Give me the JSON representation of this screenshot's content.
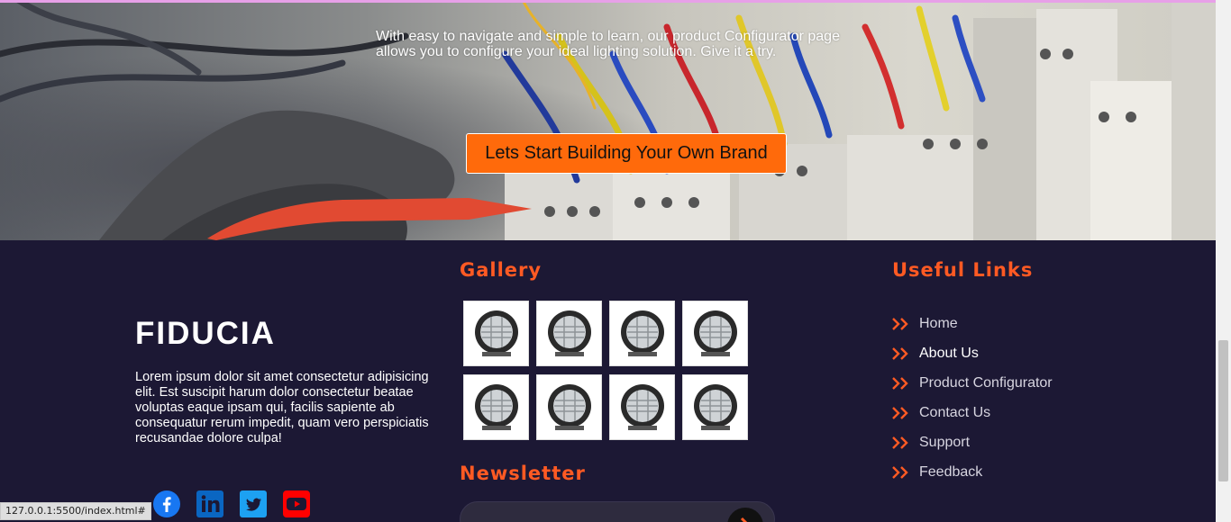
{
  "hero": {
    "description": "With easy to navigate and simple to learn, our product Configurator page allows you to configure your ideal lighting solution. Give it a try.",
    "cta_label": "Lets Start Building Your Own Brand"
  },
  "footer": {
    "brand": "FIDUCIA",
    "about": "Lorem ipsum dolor sit amet consectetur adipisicing elit. Est suscipit harum dolor consectetur beatae voluptas eaque ipsam qui, facilis sapiente ab consequatur rerum impedit, quam vero perspiciatis recusandae dolore culpa!",
    "socials": [
      {
        "icon": "facebook-icon",
        "color": "#1877f2"
      },
      {
        "icon": "linkedin-icon",
        "color": "#0a66c2"
      },
      {
        "icon": "twitter-icon",
        "color": "#1da1f2"
      },
      {
        "icon": "youtube-icon",
        "color": "#ff0000"
      }
    ]
  },
  "gallery": {
    "title": "Gallery",
    "images": [
      "work-light-image",
      "work-light-image",
      "work-light-image",
      "work-light-image",
      "work-light-image",
      "work-light-image",
      "work-light-image",
      "work-light-image"
    ]
  },
  "newsletter": {
    "title": "Newsletter"
  },
  "useful_links": {
    "title": "Useful Links",
    "items": [
      {
        "label": "Home"
      },
      {
        "label": "About Us"
      },
      {
        "label": "Product Configurator"
      },
      {
        "label": "Contact Us"
      },
      {
        "label": "Support"
      },
      {
        "label": "Feedback"
      }
    ]
  },
  "status_bar": "127.0.0.1:5500/index.html#",
  "colors": {
    "accent": "#ff5a23",
    "cta": "#ff6a0b",
    "footer_bg": "#1c1834"
  }
}
